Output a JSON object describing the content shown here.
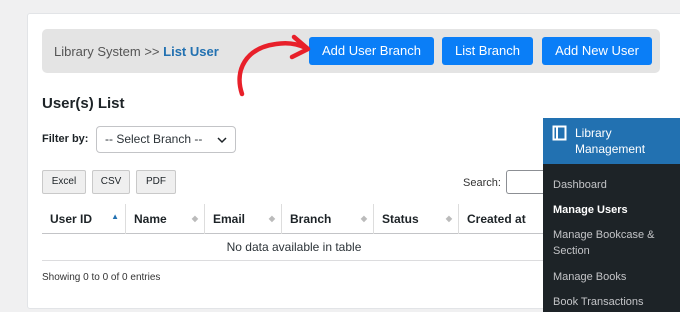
{
  "breadcrumb": {
    "root": "Library System",
    "separator": ">>",
    "current": "List User"
  },
  "actions": {
    "add_user_branch": "Add User Branch",
    "list_branch": "List Branch",
    "add_new_user": "Add New User"
  },
  "heading": "User(s) List",
  "filter": {
    "label": "Filter by:",
    "selected": "-- Select Branch --"
  },
  "export": {
    "excel": "Excel",
    "csv": "CSV",
    "pdf": "PDF"
  },
  "search": {
    "label": "Search:",
    "value": ""
  },
  "table": {
    "columns": [
      "User ID",
      "Name",
      "Email",
      "Branch",
      "Status",
      "Created at"
    ],
    "empty_message": "No data available in table",
    "info": "Showing 0 to 0 of 0 entries"
  },
  "sidebar": {
    "menu_title": "Library Management",
    "items": [
      "Dashboard",
      "Manage Users",
      "Manage Bookcase & Section",
      "Manage Books",
      "Book Transactions"
    ],
    "active_item": "Manage Users"
  },
  "colors": {
    "primary_button": "#0a7ef7",
    "sidebar_bg": "#1d2327",
    "sidebar_active": "#2271b1",
    "annotation_arrow": "#e8202a"
  }
}
